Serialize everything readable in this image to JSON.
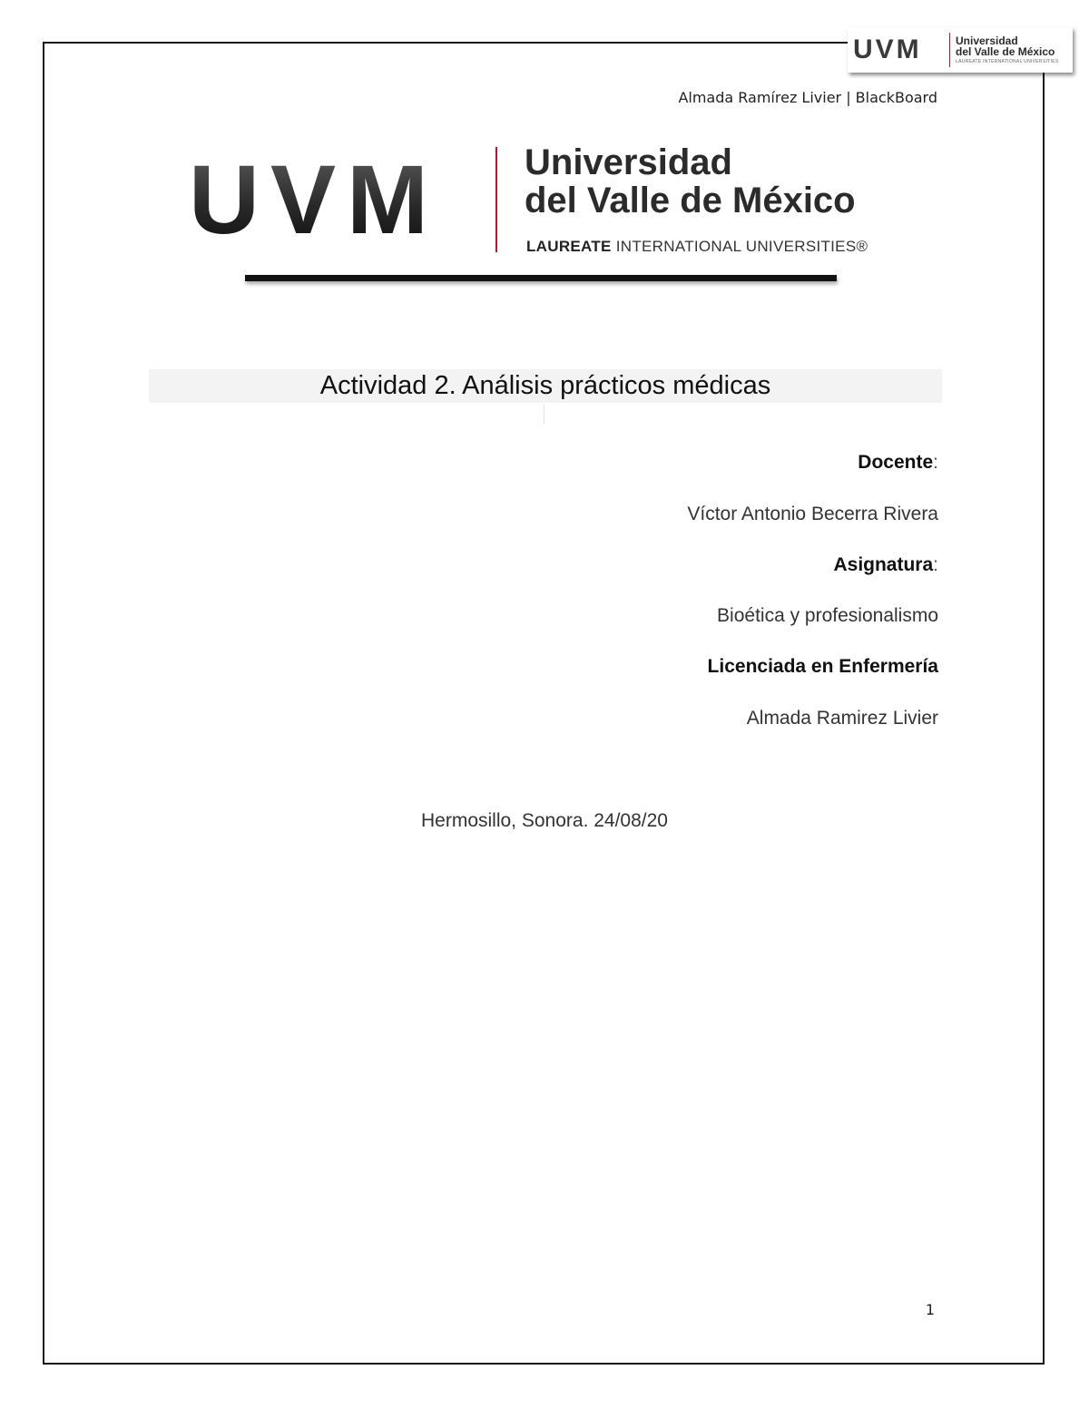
{
  "corner_logo": {
    "mark": "UVM",
    "line1": "Universidad",
    "line2": "del Valle de México",
    "line3": "LAUREATE INTERNATIONAL UNIVERSITIES"
  },
  "header": {
    "text": "Almada Ramírez Livier | BlackBoard"
  },
  "main_logo": {
    "mark": "UVM",
    "name_line1": "Universidad",
    "name_line2": "del Valle de México",
    "laureate_bold": "LAUREATE",
    "laureate_rest": "INTERNATIONAL UNIVERSITIES®"
  },
  "title": "Actividad 2. Análisis prácticos médicas",
  "info": {
    "docente_label": "Docente",
    "docente_value": "Víctor Antonio Becerra Rivera",
    "asignatura_label": "Asignatura",
    "asignatura_value": "Bioética y profesionalismo",
    "carrera_label": "Licenciada en Enfermería",
    "alumna_value": "Almada Ramirez Livier",
    "colon": ":"
  },
  "place_date": "Hermosillo, Sonora.  24/08/20",
  "page_number": "1",
  "colors": {
    "accent_red": "#c8102e",
    "logo_gray": "#2b2b2b"
  }
}
